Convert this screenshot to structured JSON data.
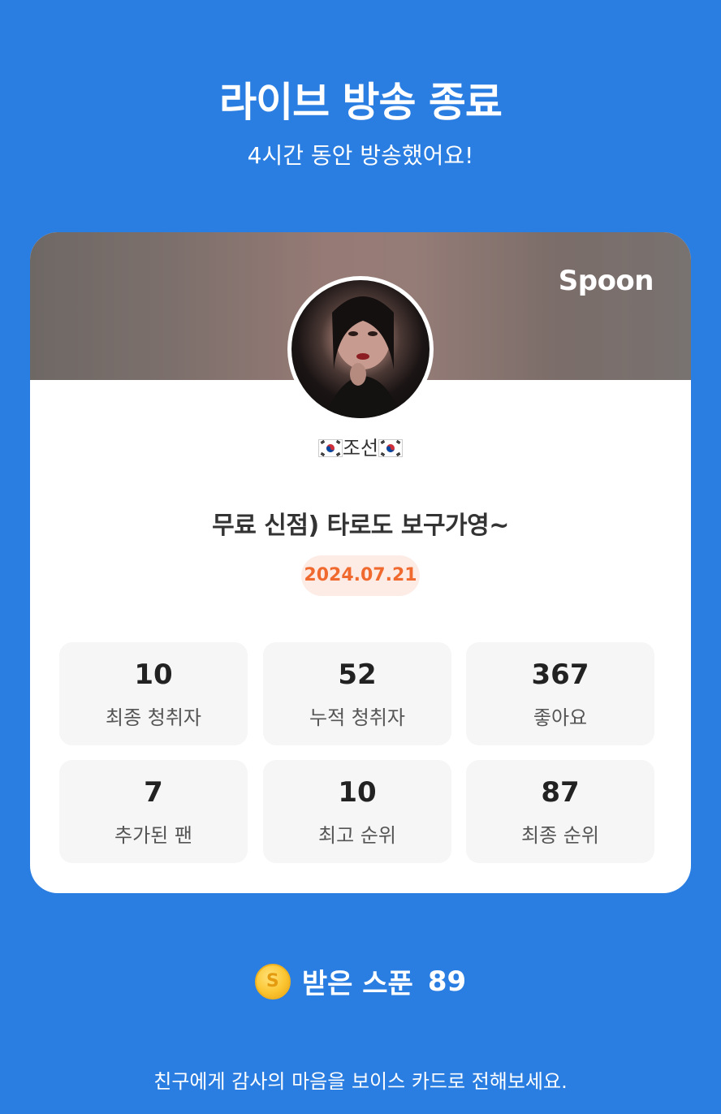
{
  "header": {
    "title": "라이브 방송 종료",
    "subtitle": "4시간 동안 방송했어요!"
  },
  "card": {
    "brand": "Spoon",
    "nickname": "조선",
    "live_title": "무료 신점) 타로도 보구가영~",
    "date": "2024.07.21",
    "stats": [
      {
        "value": "10",
        "label": "최종 청취자"
      },
      {
        "value": "52",
        "label": "누적 청취자"
      },
      {
        "value": "367",
        "label": "좋아요"
      },
      {
        "value": "7",
        "label": "추가된 팬"
      },
      {
        "value": "10",
        "label": "최고 순위"
      },
      {
        "value": "87",
        "label": "최종 순위"
      }
    ]
  },
  "spoons": {
    "coin_symbol": "S",
    "label": "받은 스푼",
    "count": "89"
  },
  "footer": {
    "text": "친구에게 감사의 마음을 보이스 카드로 전해보세요."
  },
  "colors": {
    "background": "#2a7de1",
    "date_accent": "#f06a2f",
    "coin": "#fbc531"
  },
  "icons": [
    "korea-flag-icon",
    "coin-icon"
  ]
}
